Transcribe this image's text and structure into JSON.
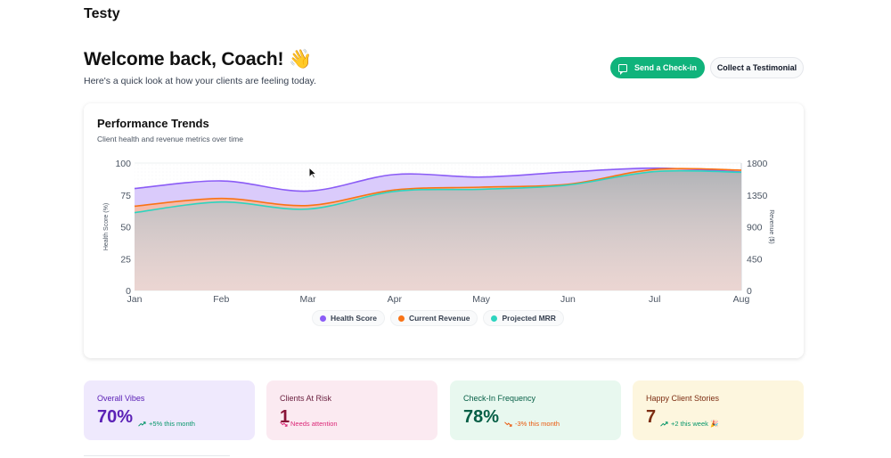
{
  "app": {
    "title": "Testy"
  },
  "welcome": {
    "heading": "Welcome back, Coach! 👋",
    "subtitle": "Here's a quick look at how your clients are feeling today."
  },
  "actions": {
    "primary_label": "Send a Check-in",
    "secondary_label": "Collect a Testimonial"
  },
  "performance": {
    "title": "Performance Trends",
    "subtitle": "Client health and revenue metrics over time"
  },
  "chart_data": {
    "type": "area",
    "categories": [
      "Jan",
      "Feb",
      "Mar",
      "Apr",
      "May",
      "Jun",
      "Jul",
      "Aug"
    ],
    "ylabel": "Health Score (%)",
    "ylabel_right": "Revenue ($)",
    "ylim": [
      0,
      100
    ],
    "ylim_right": [
      0,
      1800
    ],
    "yticks": [
      "0",
      "25",
      "50",
      "75",
      "100"
    ],
    "yticks_right": [
      "0",
      "450",
      "900",
      "1350",
      "1800"
    ],
    "series": [
      {
        "name": "Health Score",
        "color": "#8b5cf6",
        "axis": "left",
        "values": [
          80,
          86,
          78,
          91,
          89,
          93,
          96,
          93
        ]
      },
      {
        "name": "Current Revenue",
        "color": "#f97316",
        "axis": "right",
        "values": [
          1190,
          1300,
          1200,
          1420,
          1460,
          1500,
          1710,
          1700
        ]
      },
      {
        "name": "Projected MRR",
        "color": "#2dd4bf",
        "axis": "right",
        "values": [
          1100,
          1250,
          1150,
          1400,
          1430,
          1490,
          1680,
          1670
        ]
      }
    ],
    "legend": "bottom-center",
    "grid": true
  },
  "stats": [
    {
      "label": "Overall Vibes",
      "value": "70%",
      "trend": "+5% this month",
      "direction": "up",
      "color": "#059669"
    },
    {
      "label": "Clients At Risk",
      "value": "1",
      "trend": "Needs attention",
      "direction": "down",
      "color": "#db2777"
    },
    {
      "label": "Check-In Frequency",
      "value": "78%",
      "trend": "-3% this month",
      "direction": "down",
      "color": "#ea580c"
    },
    {
      "label": "Happy Client Stories",
      "value": "7",
      "trend": "+2 this week 🎉",
      "direction": "up",
      "color": "#059669"
    }
  ],
  "icons": {
    "chat": "chat-bubble-icon",
    "trend_up": "trend-up-icon",
    "trend_down": "trend-down-icon"
  }
}
